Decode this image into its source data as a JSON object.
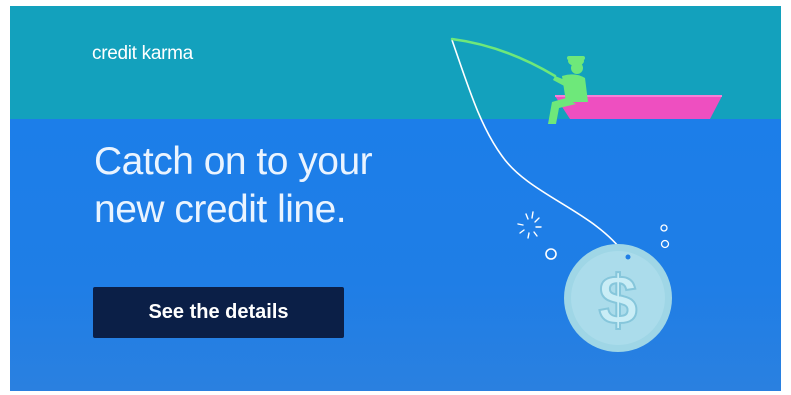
{
  "brand": {
    "logo_text": "credit karma"
  },
  "headline": {
    "line1": "Catch on to your",
    "line2": "new credit line."
  },
  "cta": {
    "label": "See the details"
  },
  "illustration": {
    "coin_symbol": "$"
  },
  "colors": {
    "sky": "#13a1bd",
    "water": "#1f7ee6",
    "button": "#0b1f47",
    "boat": "#ee4fc0",
    "fisherman": "#6ee87a",
    "coin": "#9fd6e6"
  }
}
